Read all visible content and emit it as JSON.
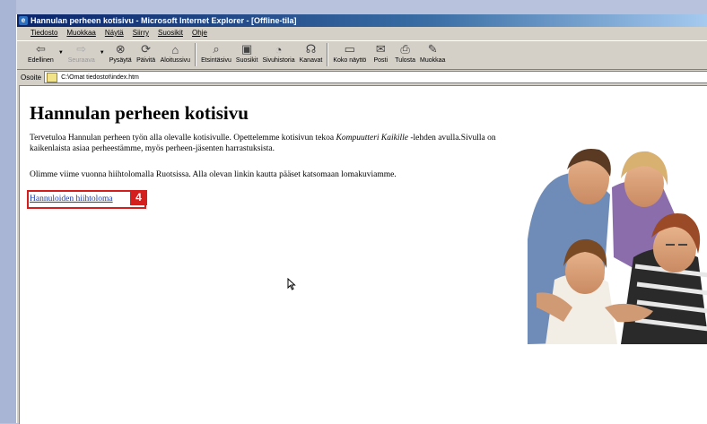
{
  "window": {
    "title": "Hannulan perheen kotisivu - Microsoft Internet Explorer - [Offline-tila]"
  },
  "menu": [
    "Tiedosto",
    "Muokkaa",
    "Näytä",
    "Siirry",
    "Suosikit",
    "Ohje"
  ],
  "toolbar": [
    {
      "label": "Edellinen",
      "icon": "back-arrow-icon",
      "disabled": false
    },
    {
      "label": "Seuraava",
      "icon": "forward-arrow-icon",
      "disabled": true
    },
    {
      "label": "Pysäytä",
      "icon": "stop-icon",
      "disabled": false
    },
    {
      "label": "Päivitä",
      "icon": "refresh-icon",
      "disabled": false
    },
    {
      "label": "Aloitussivu",
      "icon": "home-icon",
      "disabled": false
    },
    {
      "label": "Etsintäsivu",
      "icon": "search-icon",
      "disabled": false
    },
    {
      "label": "Suosikit",
      "icon": "favorites-icon",
      "disabled": false
    },
    {
      "label": "Sivuhistoria",
      "icon": "history-icon",
      "disabled": false
    },
    {
      "label": "Kanavat",
      "icon": "channels-icon",
      "disabled": false
    },
    {
      "label": "Koko näyttö",
      "icon": "fullscreen-icon",
      "disabled": false
    },
    {
      "label": "Posti",
      "icon": "mail-icon",
      "disabled": false
    },
    {
      "label": "Tulosta",
      "icon": "print-icon",
      "disabled": false
    },
    {
      "label": "Muokkaa",
      "icon": "edit-icon",
      "disabled": false
    }
  ],
  "address": {
    "label": "Osoite",
    "value": "C:\\Omat tiedostot\\index.htm"
  },
  "page": {
    "title": "Hannulan perheen kotisivu",
    "intro_1": "Tervetuloa Hannulan perheen työn alla olevalle kotisivulle. Opettelemme kotisivun tekoa ",
    "intro_em": "Kompuutteri Kaikille",
    "intro_2": " -lehden avulla.Sivulla on kaikenlaista asiaa perheestämme, myös perheen-jäsenten harrastuksista.",
    "para_2": "Olimme viime vuonna hiihtolomalla Ruotsissa. Alla olevan linkin kautta pääset katsomaan lomakuviamme.",
    "link": "Hannuloiden hiihtoloma",
    "step_badge": "4"
  }
}
